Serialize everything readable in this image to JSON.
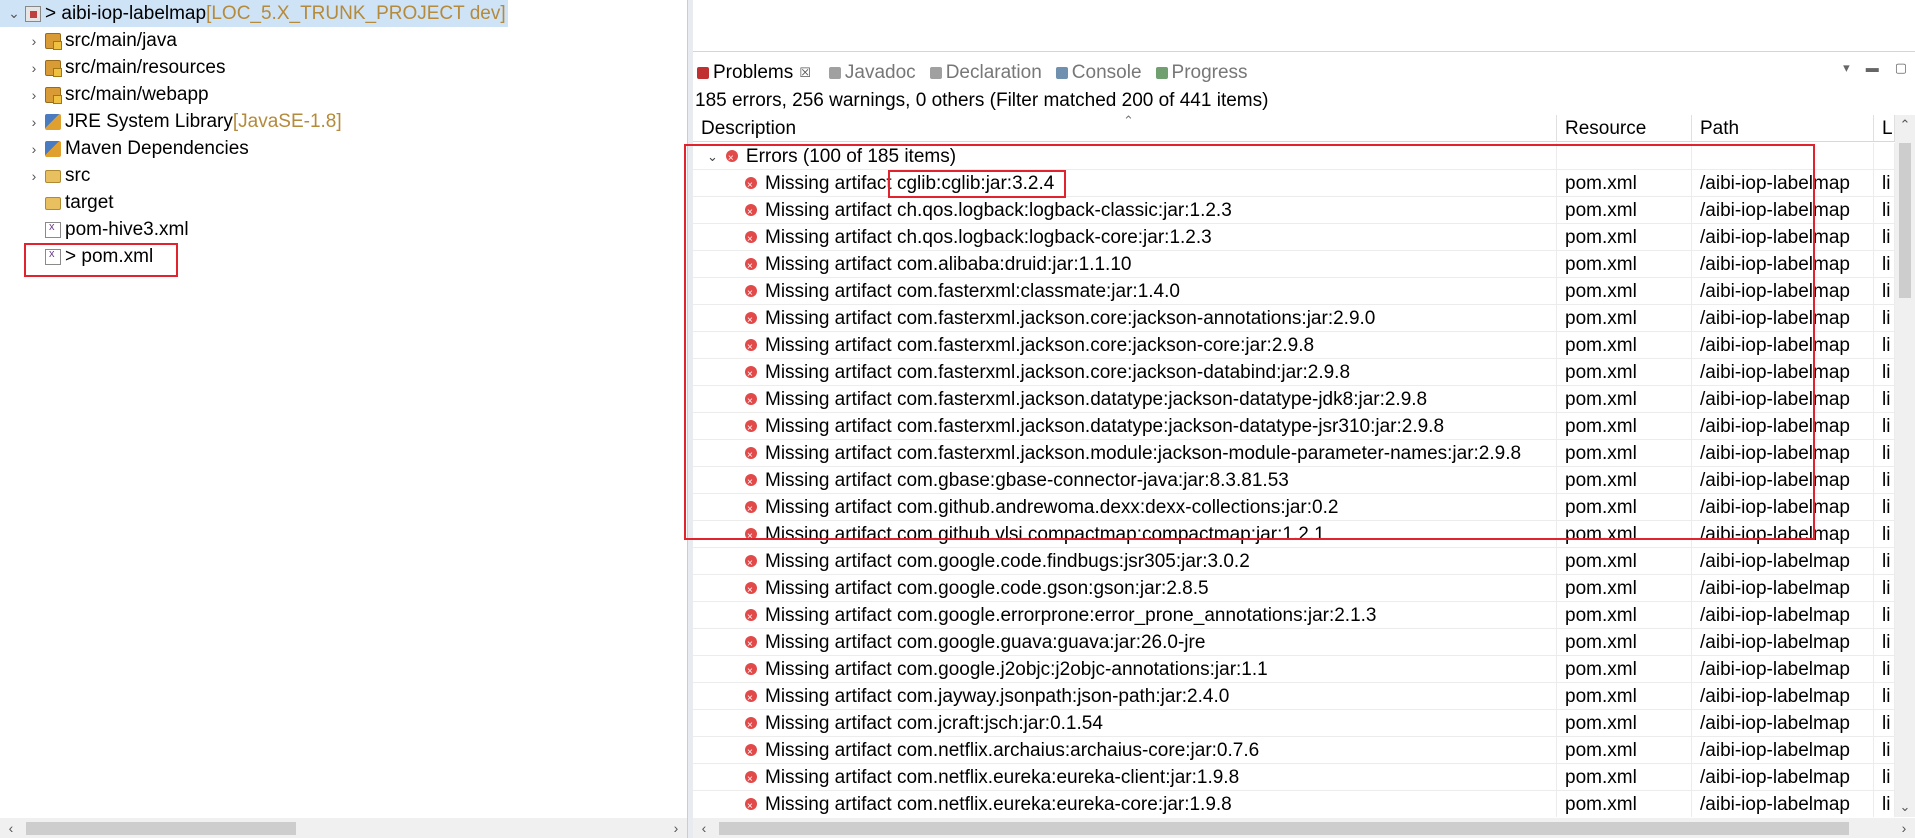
{
  "explorer": {
    "items": [
      {
        "twisty": "⌄",
        "icon": "project-icon",
        "label": "> aibi-iop-labelmap",
        "decor": " [LOC_5.X_TRUNK_PROJECT dev]"
      },
      {
        "twisty": "›",
        "icon": "package-folder-icon",
        "label": "src/main/java",
        "decor": ""
      },
      {
        "twisty": "›",
        "icon": "package-folder-icon",
        "label": "src/main/resources",
        "decor": ""
      },
      {
        "twisty": "›",
        "icon": "package-folder-icon",
        "label": "src/main/webapp",
        "decor": ""
      },
      {
        "twisty": "›",
        "icon": "library-icon",
        "label": "JRE System Library",
        "decor": " [JavaSE-1.8]"
      },
      {
        "twisty": "›",
        "icon": "library-icon",
        "label": "Maven Dependencies",
        "decor": ""
      },
      {
        "twisty": "›",
        "icon": "folder-icon",
        "label": "src",
        "decor": ""
      },
      {
        "twisty": "",
        "icon": "folder-icon",
        "label": "target",
        "decor": ""
      },
      {
        "twisty": "",
        "icon": "xml-file-icon",
        "label": "pom-hive3.xml",
        "decor": ""
      },
      {
        "twisty": "",
        "icon": "xml-file-icon",
        "label": "> pom.xml",
        "decor": ""
      }
    ]
  },
  "problems": {
    "tabs": [
      {
        "label": "Problems",
        "icon": "problems-icon",
        "color": "#c03030"
      },
      {
        "label": "Javadoc",
        "icon": "javadoc-icon",
        "color": "#a0a0a0"
      },
      {
        "label": "Declaration",
        "icon": "declaration-icon",
        "color": "#a0a0a0"
      },
      {
        "label": "Console",
        "icon": "console-icon",
        "color": "#7090b0"
      },
      {
        "label": "Progress",
        "icon": "progress-icon",
        "color": "#70a070"
      }
    ],
    "tab_close": "☒",
    "summary": "185 errors, 256 warnings, 0 others (Filter matched 200 of 441 items)",
    "columns": {
      "description": "Description",
      "resource": "Resource",
      "path": "Path",
      "location": "L"
    },
    "group_label": "Errors (100 of 185 items)",
    "rows": [
      {
        "desc": "Missing artifact cglib:cglib:jar:3.2.4",
        "resource": "pom.xml",
        "path": "/aibi-iop-labelmap",
        "loc": "li"
      },
      {
        "desc": "Missing artifact ch.qos.logback:logback-classic:jar:1.2.3",
        "resource": "pom.xml",
        "path": "/aibi-iop-labelmap",
        "loc": "li"
      },
      {
        "desc": "Missing artifact ch.qos.logback:logback-core:jar:1.2.3",
        "resource": "pom.xml",
        "path": "/aibi-iop-labelmap",
        "loc": "li"
      },
      {
        "desc": "Missing artifact com.alibaba:druid:jar:1.1.10",
        "resource": "pom.xml",
        "path": "/aibi-iop-labelmap",
        "loc": "li"
      },
      {
        "desc": "Missing artifact com.fasterxml:classmate:jar:1.4.0",
        "resource": "pom.xml",
        "path": "/aibi-iop-labelmap",
        "loc": "li"
      },
      {
        "desc": "Missing artifact com.fasterxml.jackson.core:jackson-annotations:jar:2.9.0",
        "resource": "pom.xml",
        "path": "/aibi-iop-labelmap",
        "loc": "li"
      },
      {
        "desc": "Missing artifact com.fasterxml.jackson.core:jackson-core:jar:2.9.8",
        "resource": "pom.xml",
        "path": "/aibi-iop-labelmap",
        "loc": "li"
      },
      {
        "desc": "Missing artifact com.fasterxml.jackson.core:jackson-databind:jar:2.9.8",
        "resource": "pom.xml",
        "path": "/aibi-iop-labelmap",
        "loc": "li"
      },
      {
        "desc": "Missing artifact com.fasterxml.jackson.datatype:jackson-datatype-jdk8:jar:2.9.8",
        "resource": "pom.xml",
        "path": "/aibi-iop-labelmap",
        "loc": "li"
      },
      {
        "desc": "Missing artifact com.fasterxml.jackson.datatype:jackson-datatype-jsr310:jar:2.9.8",
        "resource": "pom.xml",
        "path": "/aibi-iop-labelmap",
        "loc": "li"
      },
      {
        "desc": "Missing artifact com.fasterxml.jackson.module:jackson-module-parameter-names:jar:2.9.8",
        "resource": "pom.xml",
        "path": "/aibi-iop-labelmap",
        "loc": "li"
      },
      {
        "desc": "Missing artifact com.gbase:gbase-connector-java:jar:8.3.81.53",
        "resource": "pom.xml",
        "path": "/aibi-iop-labelmap",
        "loc": "li"
      },
      {
        "desc": "Missing artifact com.github.andrewoma.dexx:dexx-collections:jar:0.2",
        "resource": "pom.xml",
        "path": "/aibi-iop-labelmap",
        "loc": "li"
      },
      {
        "desc": "Missing artifact com.github.vlsi.compactmap:compactmap:jar:1.2.1",
        "resource": "pom.xml",
        "path": "/aibi-iop-labelmap",
        "loc": "li"
      },
      {
        "desc": "Missing artifact com.google.code.findbugs:jsr305:jar:3.0.2",
        "resource": "pom.xml",
        "path": "/aibi-iop-labelmap",
        "loc": "li"
      },
      {
        "desc": "Missing artifact com.google.code.gson:gson:jar:2.8.5",
        "resource": "pom.xml",
        "path": "/aibi-iop-labelmap",
        "loc": "li"
      },
      {
        "desc": "Missing artifact com.google.errorprone:error_prone_annotations:jar:2.1.3",
        "resource": "pom.xml",
        "path": "/aibi-iop-labelmap",
        "loc": "li"
      },
      {
        "desc": "Missing artifact com.google.guava:guava:jar:26.0-jre",
        "resource": "pom.xml",
        "path": "/aibi-iop-labelmap",
        "loc": "li"
      },
      {
        "desc": "Missing artifact com.google.j2objc:j2objc-annotations:jar:1.1",
        "resource": "pom.xml",
        "path": "/aibi-iop-labelmap",
        "loc": "li"
      },
      {
        "desc": "Missing artifact com.jayway.jsonpath:json-path:jar:2.4.0",
        "resource": "pom.xml",
        "path": "/aibi-iop-labelmap",
        "loc": "li"
      },
      {
        "desc": "Missing artifact com.jcraft:jsch:jar:0.1.54",
        "resource": "pom.xml",
        "path": "/aibi-iop-labelmap",
        "loc": "li"
      },
      {
        "desc": "Missing artifact com.netflix.archaius:archaius-core:jar:0.7.6",
        "resource": "pom.xml",
        "path": "/aibi-iop-labelmap",
        "loc": "li"
      },
      {
        "desc": "Missing artifact com.netflix.eureka:eureka-client:jar:1.9.8",
        "resource": "pom.xml",
        "path": "/aibi-iop-labelmap",
        "loc": "li"
      },
      {
        "desc": "Missing artifact com.netflix.eureka:eureka-core:jar:1.9.8",
        "resource": "pom.xml",
        "path": "/aibi-iop-labelmap",
        "loc": "li"
      }
    ]
  },
  "colors": {
    "highlight": "#e0232d",
    "selection": "#cfe3f7",
    "error": "#e24a4a"
  }
}
